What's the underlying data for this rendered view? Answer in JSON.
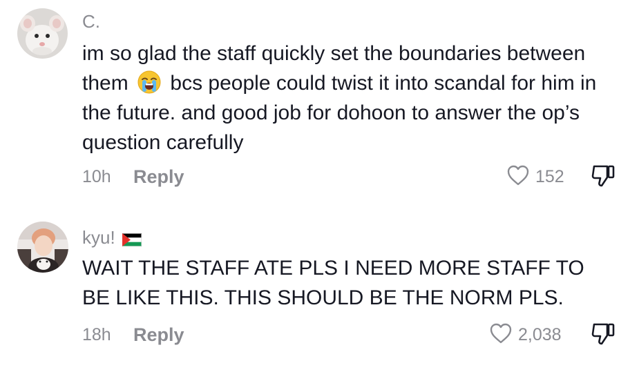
{
  "comments": [
    {
      "username": "C.",
      "text_before_emoji": "im so glad the staff quickly set the boundaries between them",
      "emoji": "loudly-crying-face",
      "text_after_emoji": "bcs people could twist it into scandal for him in the future. and good job for dohoon to answer the op’s question carefully",
      "timestamp": "10h",
      "reply_label": "Reply",
      "like_count": "152"
    },
    {
      "username": "kyu!",
      "flag": "palestine-flag",
      "text": "WAIT THE STAFF ATE PLS I NEED MORE STAFF TO BE LIKE THIS. THIS SHOULD BE THE NORM PLS.",
      "timestamp": "18h",
      "reply_label": "Reply",
      "like_count": "2,038"
    }
  ],
  "colors": {
    "text_primary": "#161823",
    "text_secondary": "#8a8b91",
    "background": "#ffffff"
  }
}
